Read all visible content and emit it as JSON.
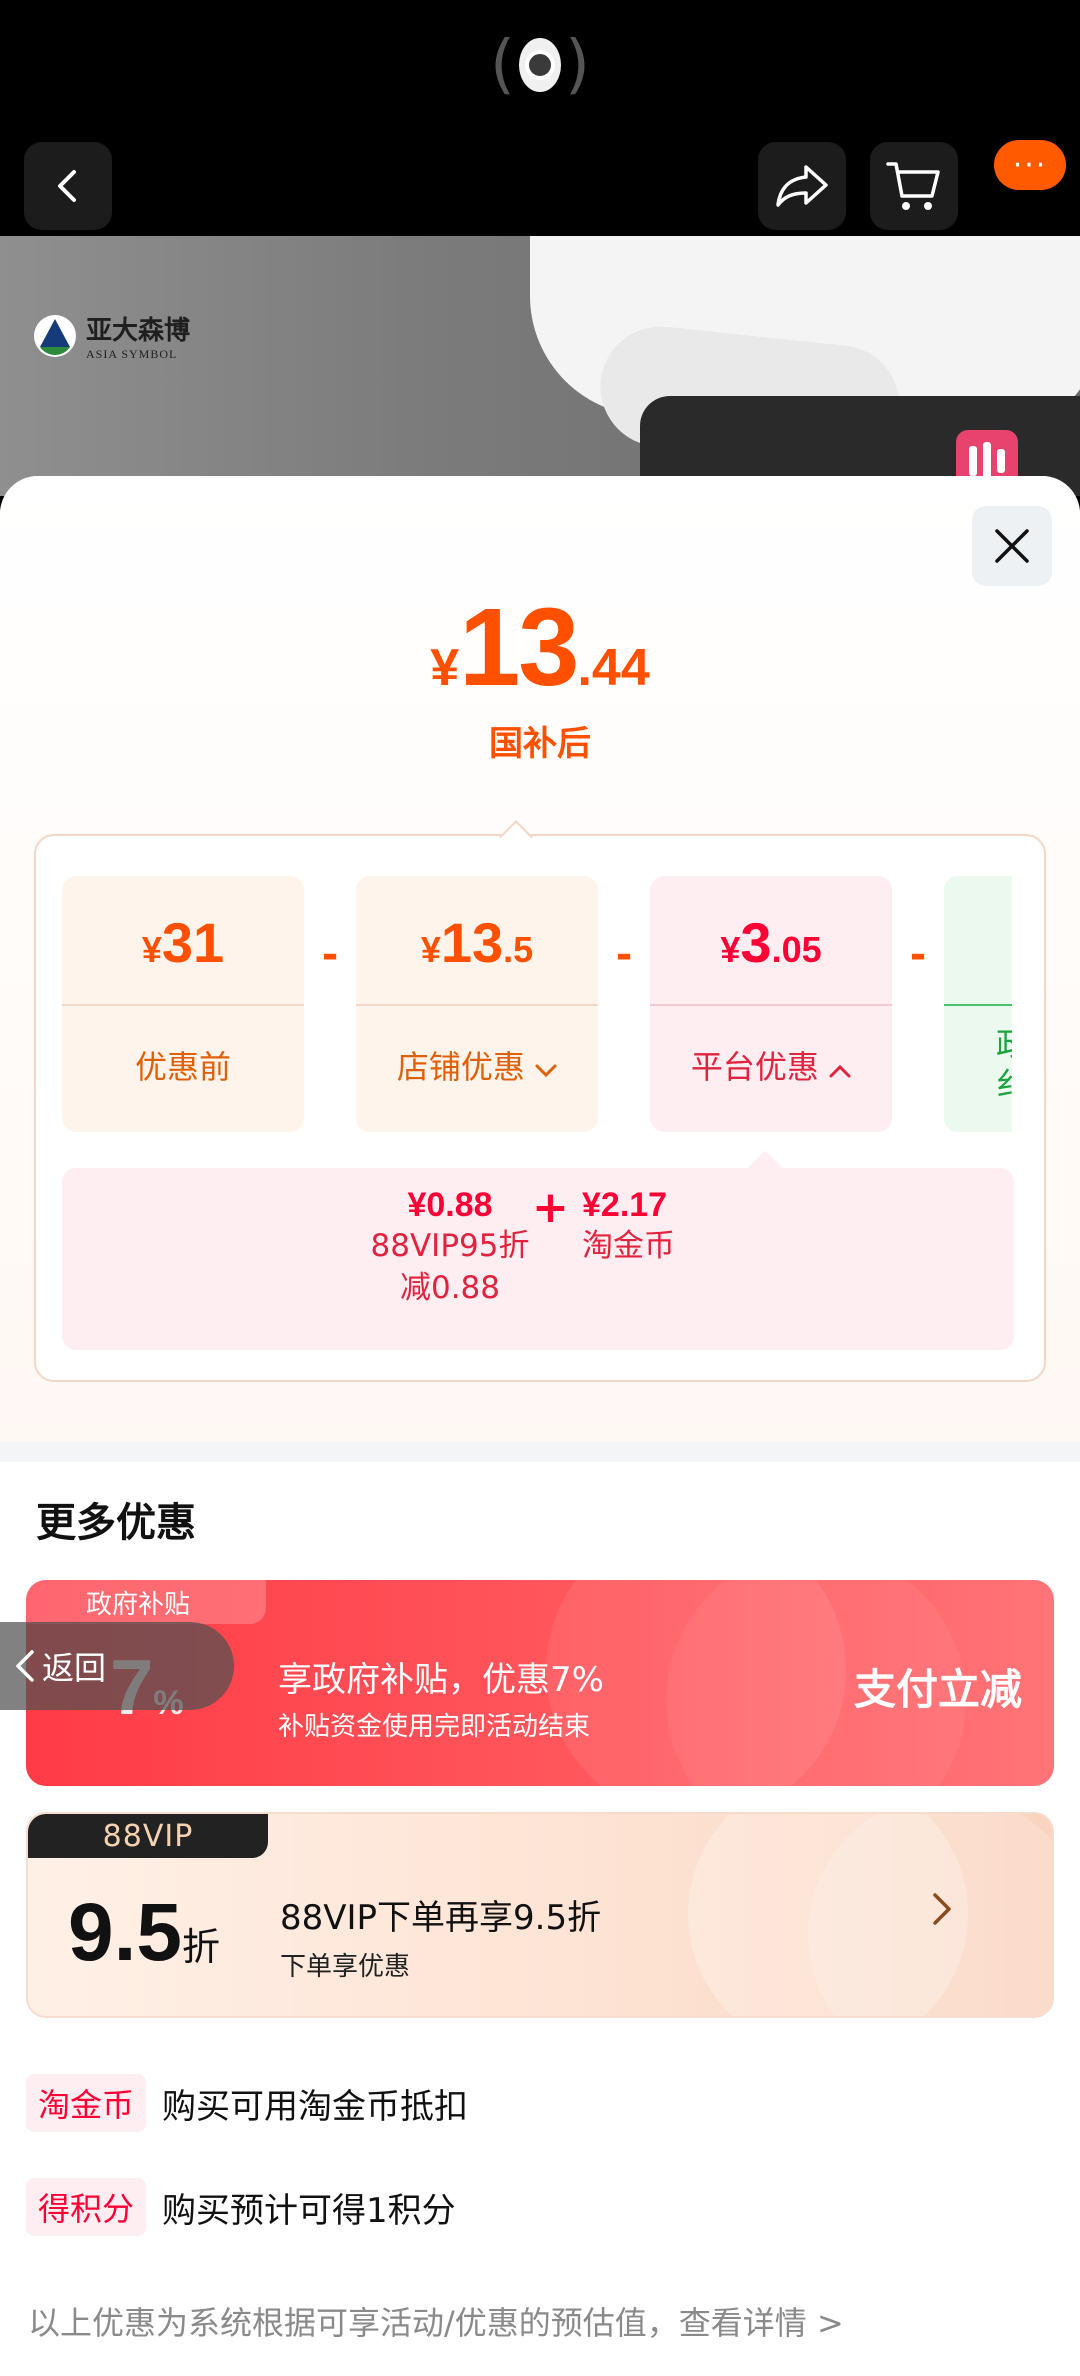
{
  "header": {
    "back_icon": "chevron-left-icon",
    "share_icon": "share-icon",
    "cart_icon": "cart-icon",
    "more_label": "···"
  },
  "product": {
    "brand_cn": "亚大森博",
    "brand_en": "ASIA SYMBOL"
  },
  "price": {
    "currency": "¥",
    "integer": "13",
    "decimal": ".44",
    "caption": "国补后"
  },
  "breakdown": {
    "cards": [
      {
        "currency": "¥",
        "integer": "31",
        "decimal": "",
        "label": "优惠前"
      },
      {
        "currency": "¥",
        "integer": "13",
        "decimal": ".5",
        "label": "店铺优惠"
      },
      {
        "currency": "¥",
        "integer": "3",
        "decimal": ".05",
        "label": "平台优惠"
      },
      {
        "currency": "",
        "integer": "",
        "decimal": "",
        "label": "政\n纟"
      }
    ],
    "minus": "-",
    "platform_detail": [
      {
        "amount": "¥0.88",
        "desc_line1": "88VIP95折",
        "desc_line2": "减0.88"
      },
      {
        "amount": "¥2.17",
        "desc_line1": "淘金币",
        "desc_line2": ""
      }
    ],
    "plus": "+"
  },
  "more": {
    "title": "更多优惠",
    "gov": {
      "tag": "政府补贴",
      "big": "7",
      "big_unit": "%",
      "headline": "享政府补贴，优惠7%",
      "subline": "补贴资金使用完即活动结束",
      "action": "支付立减"
    },
    "vip": {
      "tag": "88VIP",
      "big": "9.5",
      "big_unit": "折",
      "headline": "88VIP下单再享9.5折",
      "subline": "下单享优惠"
    },
    "rows": [
      {
        "chip": "淘金币",
        "text": "购买可用淘金币抵扣"
      },
      {
        "chip": "得积分",
        "text": "购买预计可得1积分"
      }
    ],
    "footer": "以上优惠为系统根据可享活动/优惠的预估值，查看详情 >"
  },
  "overlay": {
    "back_label": "返回"
  },
  "colors": {
    "accent_orange": "#ff5000",
    "accent_red": "#ff0036",
    "green": "#1aa33f"
  }
}
